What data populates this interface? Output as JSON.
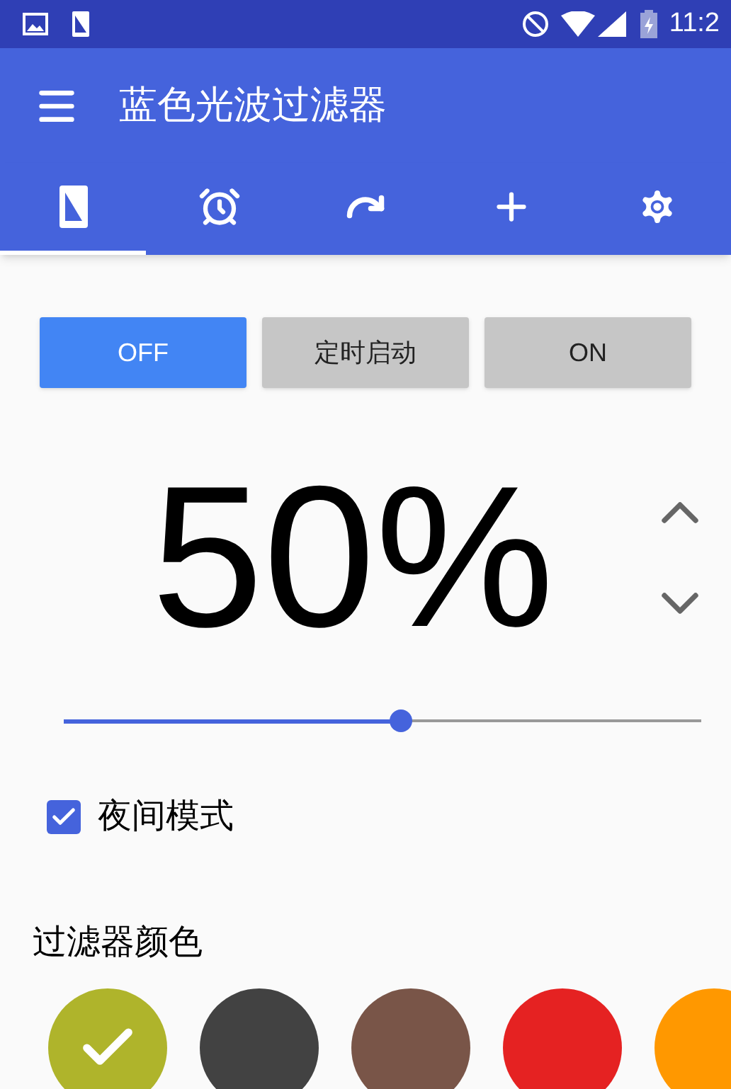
{
  "status_bar": {
    "time": "11:2"
  },
  "app_bar": {
    "title": "蓝色光波过滤器"
  },
  "tabs": [
    {
      "kind": "screen",
      "selected": true
    },
    {
      "kind": "alarm",
      "selected": false
    },
    {
      "kind": "redo",
      "selected": false
    },
    {
      "kind": "add",
      "selected": false
    },
    {
      "kind": "settings",
      "selected": false
    }
  ],
  "mode_buttons": [
    {
      "label": "OFF",
      "selected": true
    },
    {
      "label": "定时启动",
      "selected": false
    },
    {
      "label": "ON",
      "selected": false
    }
  ],
  "intensity": {
    "reading": "50%",
    "level": 0.53
  },
  "night_mode": {
    "label": "夜间模式",
    "checked": true
  },
  "filter_color": {
    "title": "过滤器颜色",
    "swatches": [
      {
        "color": "#afb42b",
        "selected": true
      },
      {
        "color": "#424242",
        "selected": false
      },
      {
        "color": "#795548",
        "selected": false
      },
      {
        "color": "#e52222",
        "selected": false
      },
      {
        "color": "#ff9800",
        "selected": false
      }
    ]
  }
}
